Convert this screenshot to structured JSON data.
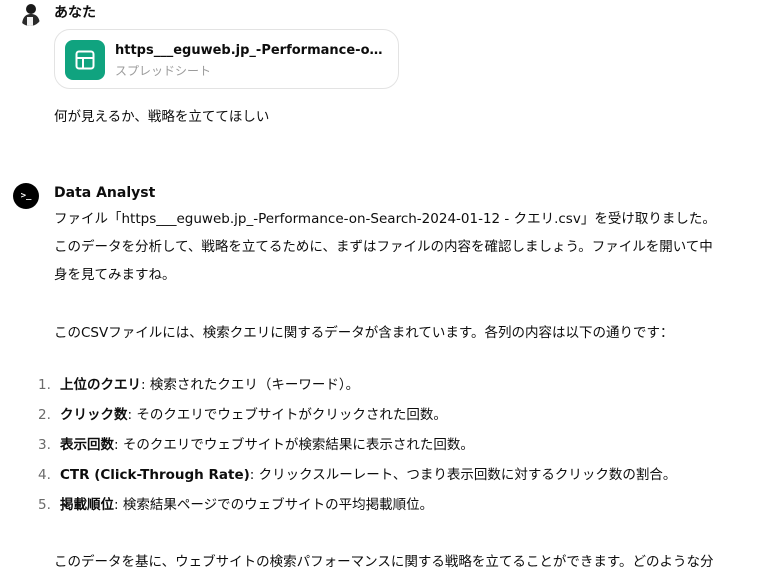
{
  "user": {
    "name": "あなた",
    "attachment": {
      "file_name": "https___eguweb.jp_-Performance-on-...",
      "file_type": "スプレッドシート",
      "icon": "spreadsheet-icon"
    },
    "message": "何が見えるか、戦略を立ててほしい"
  },
  "assistant": {
    "name": "Data Analyst",
    "avatar_glyph": ">_",
    "paragraph1": "ファイル「https___eguweb.jp_-Performance-on-Search-2024-01-12 - クエリ.csv」を受け取りました。このデータを分析して、戦略を立てるために、まずはファイルの内容を確認しましょう。ファイルを開いて中身を見てみますね。",
    "paragraph2": "このCSVファイルには、検索クエリに関するデータが含まれています。各列の内容は以下の通りです：",
    "columns": [
      {
        "num": "1.",
        "term": "上位のクエリ",
        "desc": ": 検索されたクエリ（キーワード）。"
      },
      {
        "num": "2.",
        "term": "クリック数",
        "desc": ": そのクエリでウェブサイトがクリックされた回数。"
      },
      {
        "num": "3.",
        "term": "表示回数",
        "desc": ": そのクエリでウェブサイトが検索結果に表示された回数。"
      },
      {
        "num": "4.",
        "term": "CTR (Click-Through Rate)",
        "desc": ": クリックスルーレート、つまり表示回数に対するクリック数の割合。"
      },
      {
        "num": "5.",
        "term": "掲載順位",
        "desc": ": 検索結果ページでのウェブサイトの平均掲載順位。"
      }
    ],
    "paragraph3": "このデータを基に、ウェブサイトの検索パフォーマンスに関する戦略を立てることができます。どのような分"
  }
}
